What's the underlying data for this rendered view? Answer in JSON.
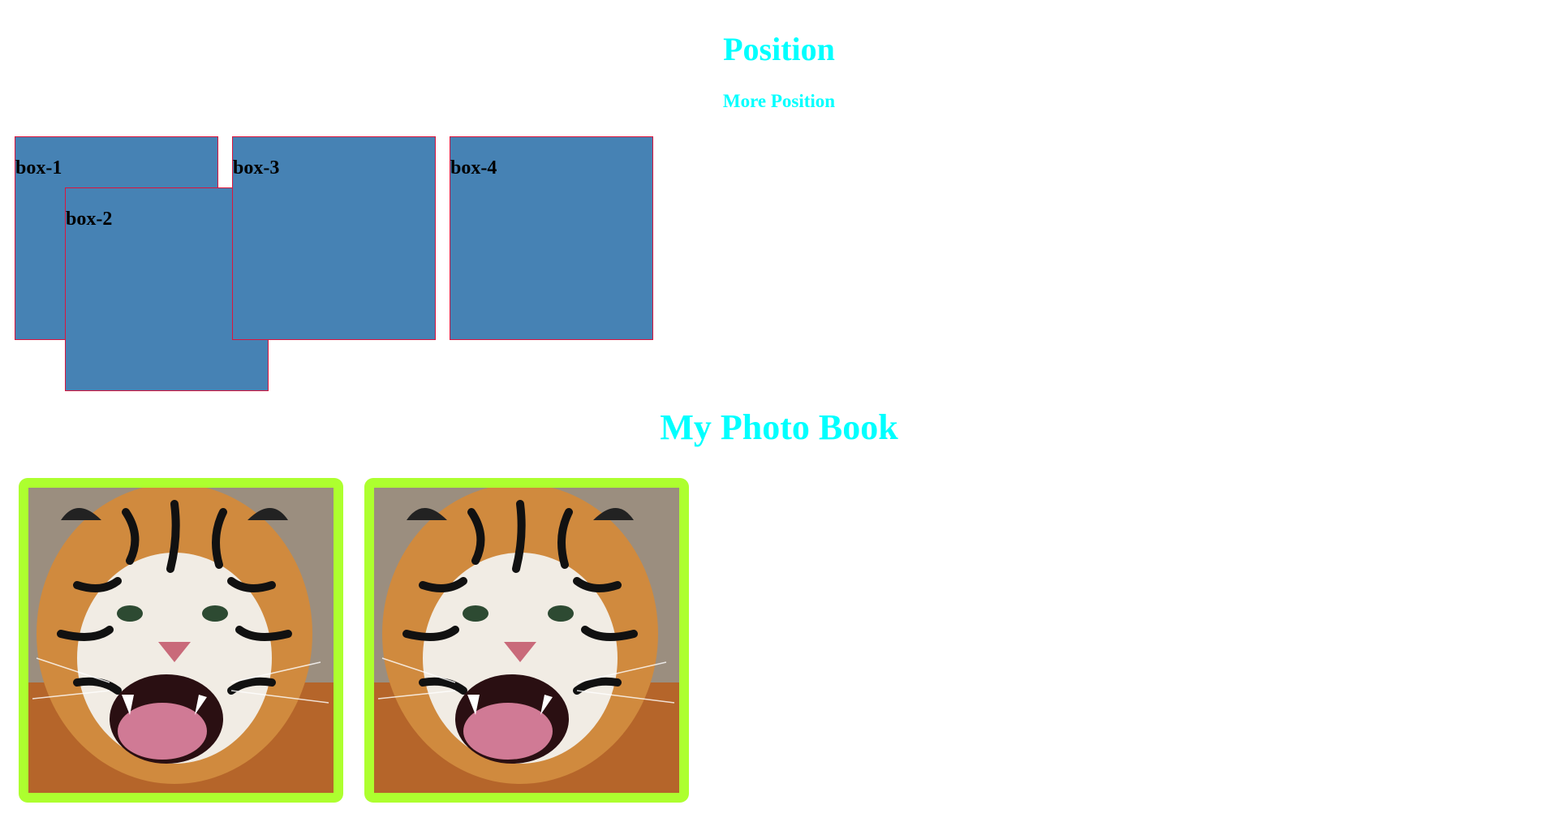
{
  "header": {
    "title": "Position",
    "subtitle": "More Position"
  },
  "boxes": [
    {
      "label": "box-1"
    },
    {
      "label": "box-2"
    },
    {
      "label": "box-3"
    },
    {
      "label": "box-4"
    }
  ],
  "photo_book": {
    "title": "My Photo Book",
    "photos": [
      {
        "subject": "tiger"
      },
      {
        "subject": "tiger"
      }
    ]
  },
  "colors": {
    "heading": "#00ffff",
    "box_fill": "#4682b4",
    "box_border": "#dc143c",
    "photo_frame": "#adff2f"
  }
}
